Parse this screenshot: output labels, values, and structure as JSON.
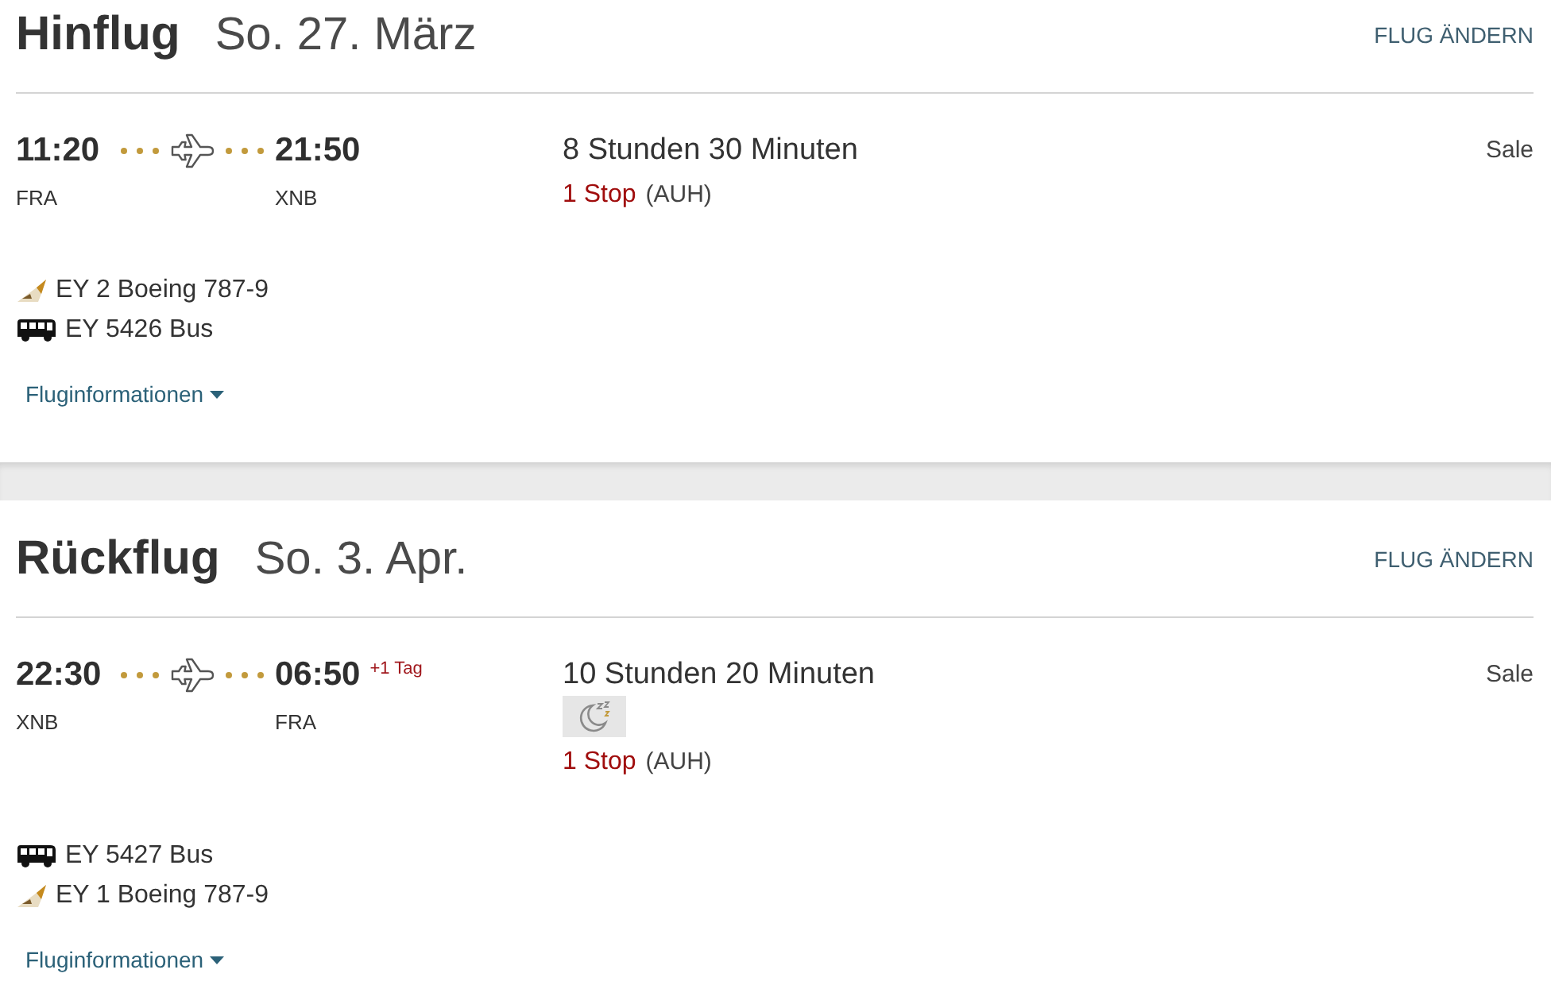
{
  "legs": [
    {
      "title": "Hinflug",
      "date": "So. 27. März",
      "change_link": "FLUG ÄNDERN",
      "departure": {
        "time": "11:20",
        "airport": "FRA"
      },
      "arrival": {
        "time": "21:50",
        "airport": "XNB"
      },
      "duration": "8 Stunden 30 Minuten",
      "overnight": false,
      "stops": "1 Stop",
      "stop_airports": "(AUH)",
      "fare": "Sale",
      "segments": [
        {
          "kind": "flight",
          "label": "EY 2 Boeing 787-9"
        },
        {
          "kind": "bus",
          "label": "EY 5426 Bus"
        }
      ],
      "details_link": "Fluginformationen"
    },
    {
      "title": "Rückflug",
      "date": "So. 3. Apr.",
      "change_link": "FLUG ÄNDERN",
      "departure": {
        "time": "22:30",
        "airport": "XNB"
      },
      "arrival": {
        "time": "06:50",
        "airport": "FRA",
        "day_offset": "+1 Tag"
      },
      "duration": "10 Stunden 20 Minuten",
      "overnight": true,
      "stops": "1 Stop",
      "stop_airports": "(AUH)",
      "fare": "Sale",
      "segments": [
        {
          "kind": "bus",
          "label": "EY 5427 Bus"
        },
        {
          "kind": "flight",
          "label": "EY 1 Boeing 787-9"
        }
      ],
      "details_link": "Fluginformationen"
    }
  ]
}
